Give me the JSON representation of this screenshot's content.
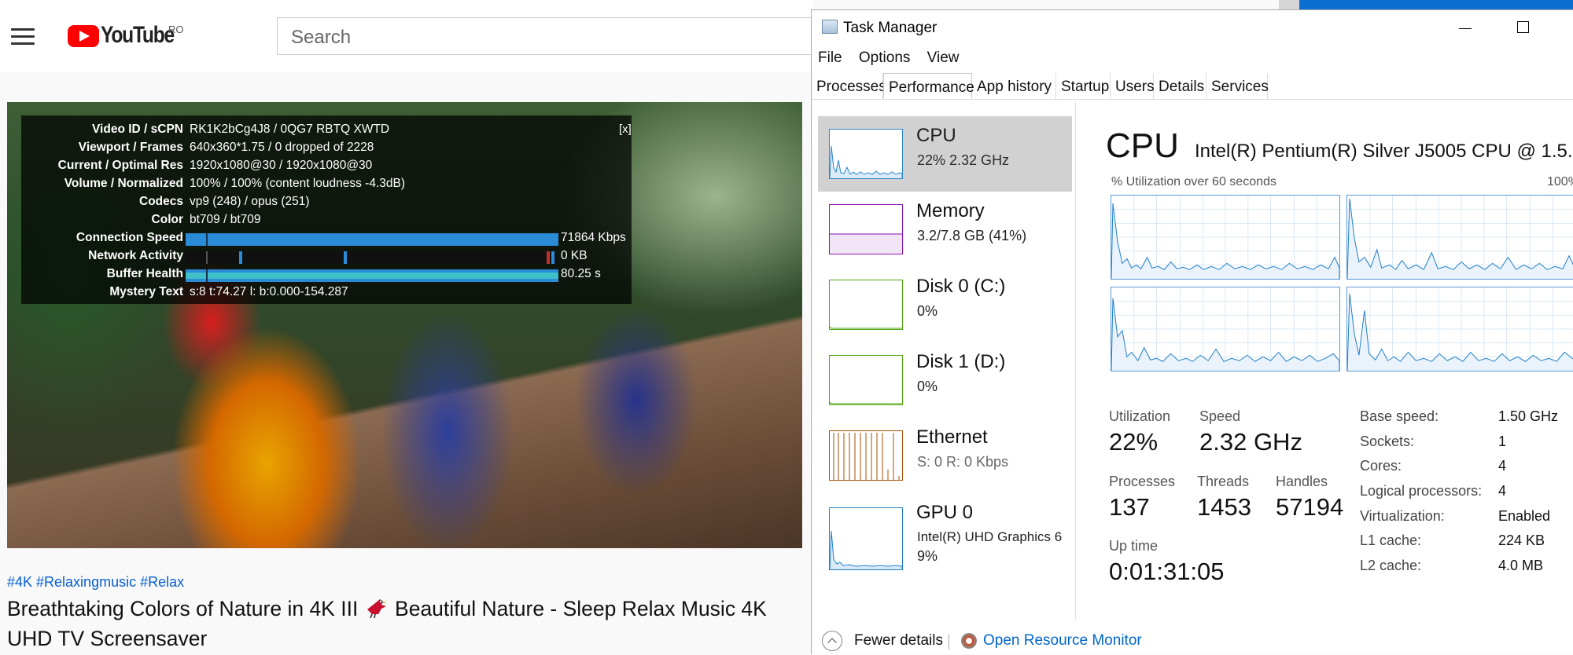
{
  "youtube": {
    "logo_text": "YouTube",
    "country": "RO",
    "search_placeholder": "Search",
    "stats": {
      "close_label": "[x]",
      "rows": [
        {
          "label": "Video ID / sCPN",
          "value": "RK1K2bCg4J8 / 0QG7 RBTQ XWTD"
        },
        {
          "label": "Viewport / Frames",
          "value": "640x360*1.75 / 0 dropped of 2228"
        },
        {
          "label": "Current / Optimal Res",
          "value": "1920x1080@30 / 1920x1080@30"
        },
        {
          "label": "Volume / Normalized",
          "value": "100% / 100% (content loudness -4.3dB)"
        },
        {
          "label": "Codecs",
          "value": "vp9 (248) / opus (251)"
        },
        {
          "label": "Color",
          "value": "bt709 / bt709"
        }
      ],
      "connection_speed": {
        "label": "Connection Speed",
        "value": "71864 Kbps"
      },
      "network_activity": {
        "label": "Network Activity",
        "value": "0 KB"
      },
      "buffer_health": {
        "label": "Buffer Health",
        "value": "80.25 s"
      },
      "mystery_text": {
        "label": "Mystery Text",
        "value": "s:8 t:74.27 l: b:0.000-154.287"
      }
    },
    "tags": "#4K #Relaxingmusic #Relax",
    "title_part1": "Breathtaking Colors of Nature in 4K III ",
    "title_part2": " Beautiful Nature - Sleep Relax Music 4K UHD TV Screensaver"
  },
  "task_manager": {
    "title": "Task Manager",
    "menu": [
      "File",
      "Options",
      "View"
    ],
    "tabs": [
      "Processes",
      "Performance",
      "App history",
      "Startup",
      "Users",
      "Details",
      "Services"
    ],
    "active_tab": "Performance",
    "sidebar": [
      {
        "name": "CPU",
        "sub": "22%  2.32 GHz",
        "color": "#1f7fc8"
      },
      {
        "name": "Memory",
        "sub": "3.2/7.8 GB (41%)",
        "color": "#8b12ae"
      },
      {
        "name": "Disk 0 (C:)",
        "sub": "0%",
        "color": "#4da60c"
      },
      {
        "name": "Disk 1 (D:)",
        "sub": "0%",
        "color": "#4da60c"
      },
      {
        "name": "Ethernet",
        "sub": "S: 0  R: 0 Kbps",
        "color": "#a74f01"
      },
      {
        "name": "GPU 0",
        "sub": "Intel(R) UHD Graphics 6",
        "sub2": "9%",
        "color": "#1f7fc8"
      }
    ],
    "cpu": {
      "heading": "CPU",
      "model": "Intel(R) Pentium(R) Silver J5005 CPU @ 1.5...",
      "graph_caption": "% Utilization over 60 seconds",
      "graph_max": "100%",
      "utilization_label": "Utilization",
      "utilization": "22%",
      "speed_label": "Speed",
      "speed": "2.32 GHz",
      "processes_label": "Processes",
      "processes": "137",
      "threads_label": "Threads",
      "threads": "1453",
      "handles_label": "Handles",
      "handles": "57194",
      "uptime_label": "Up time",
      "uptime": "0:01:31:05",
      "specs": [
        {
          "label": "Base speed:",
          "value": "1.50 GHz"
        },
        {
          "label": "Sockets:",
          "value": "1"
        },
        {
          "label": "Cores:",
          "value": "4"
        },
        {
          "label": "Logical processors:",
          "value": "4"
        },
        {
          "label": "Virtualization:",
          "value": "Enabled"
        },
        {
          "label": "L1 cache:",
          "value": "224 KB"
        },
        {
          "label": "L2 cache:",
          "value": "4.0 MB"
        }
      ]
    },
    "footer": {
      "fewer_details": "Fewer details",
      "open_resource_monitor": "Open Resource Monitor"
    }
  }
}
